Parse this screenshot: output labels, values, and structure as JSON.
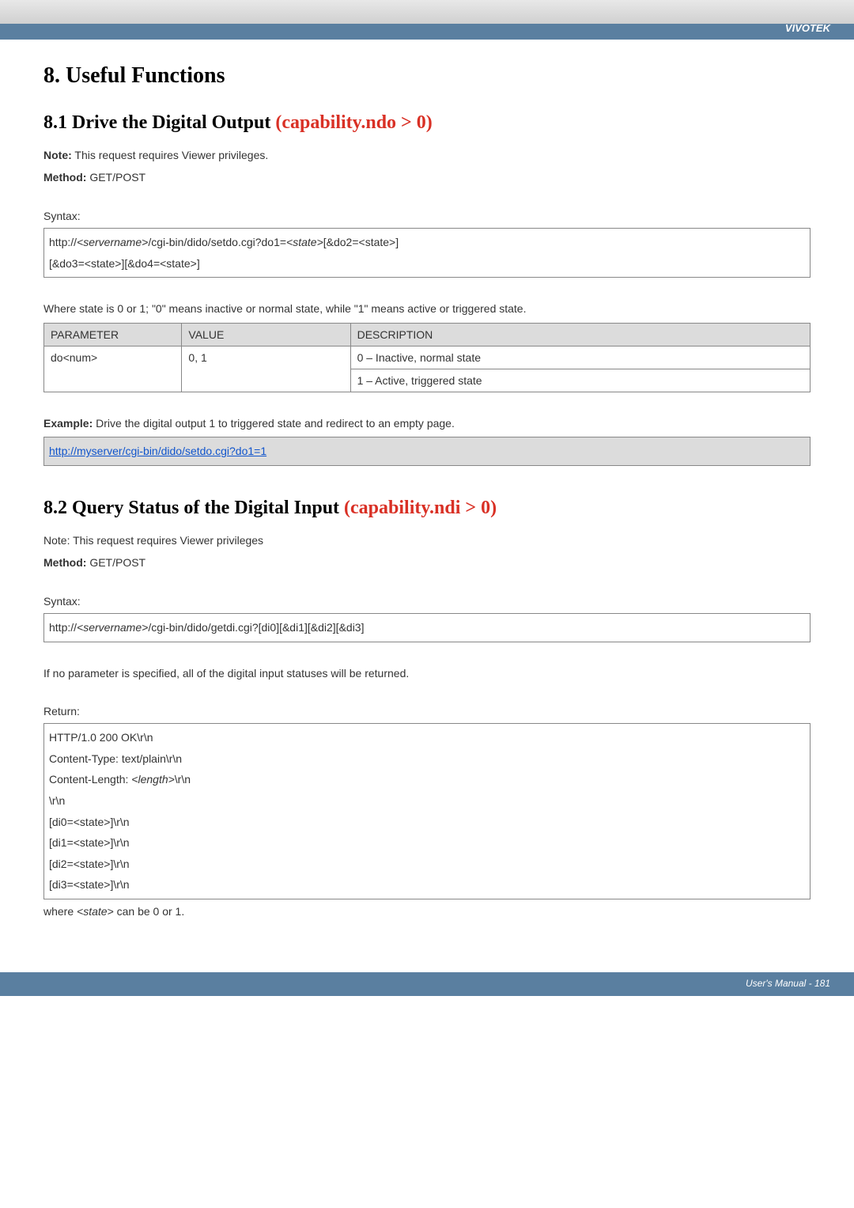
{
  "header": {
    "brand": "VIVOTEK"
  },
  "section8": {
    "title": "8. Useful Functions"
  },
  "section81": {
    "title_prefix": "8.1 Drive the Digital Output ",
    "title_cap": "(capability.ndo > 0)",
    "note_label": "Note:",
    "note_text": " This request requires Viewer privileges.",
    "method_label": "Method:",
    "method_text": " GET/POST",
    "syntax_label": "Syntax:",
    "syntax_line1_a": "http://",
    "syntax_line1_b": "<servername>",
    "syntax_line1_c": "/cgi-bin/dido/setdo.cgi?do1=",
    "syntax_line1_d": "<state>",
    "syntax_line1_e": "[&do2=<state>]",
    "syntax_line2": "[&do3=<state>][&do4=<state>]",
    "state_text": "Where state is 0 or 1; \"0\" means inactive or normal state, while \"1\" means active or triggered state.",
    "table": {
      "hdr_param": "PARAMETER",
      "hdr_value": "VALUE",
      "hdr_desc": "DESCRIPTION",
      "row_param": "do<num>",
      "row_value": "0, 1",
      "row_desc1": "0 – Inactive, normal state",
      "row_desc2": "1 – Active, triggered state"
    },
    "example_label": "Example:",
    "example_text": " Drive the digital output 1 to triggered state and redirect to an empty page.",
    "example_link": "http://myserver/cgi-bin/dido/setdo.cgi?do1=1"
  },
  "section82": {
    "title_prefix": "8.2 Query Status of the Digital Input ",
    "title_cap": "(capability.ndi > 0)",
    "note_text": "Note: This request requires Viewer privileges",
    "method_label": "Method:",
    "method_text": " GET/POST",
    "syntax_label": "Syntax:",
    "syntax_a": "http://",
    "syntax_b": "<servername>",
    "syntax_c": "/cgi-bin/dido/getdi.cgi?[di0][&di1][&di2][&di3]",
    "no_param_text": "If no parameter is specified, all of the digital input statuses will be returned.",
    "return_label": "Return:",
    "return_lines": {
      "l1": "HTTP/1.0 200 OK\\r\\n",
      "l2": "Content-Type: text/plain\\r\\n",
      "l3a": "Content-Length: ",
      "l3b": "<length>",
      "l3c": "\\r\\n",
      "l4": "\\r\\n",
      "l5": "[di0=<state>]\\r\\n",
      "l6": "[di1=<state>]\\r\\n",
      "l7": "[di2=<state>]\\r\\n",
      "l8": "[di3=<state>]\\r\\n"
    },
    "where_a": "where ",
    "where_b": "<state>",
    "where_c": " can be 0 or 1."
  },
  "footer": {
    "text": "User's Manual - 181"
  }
}
